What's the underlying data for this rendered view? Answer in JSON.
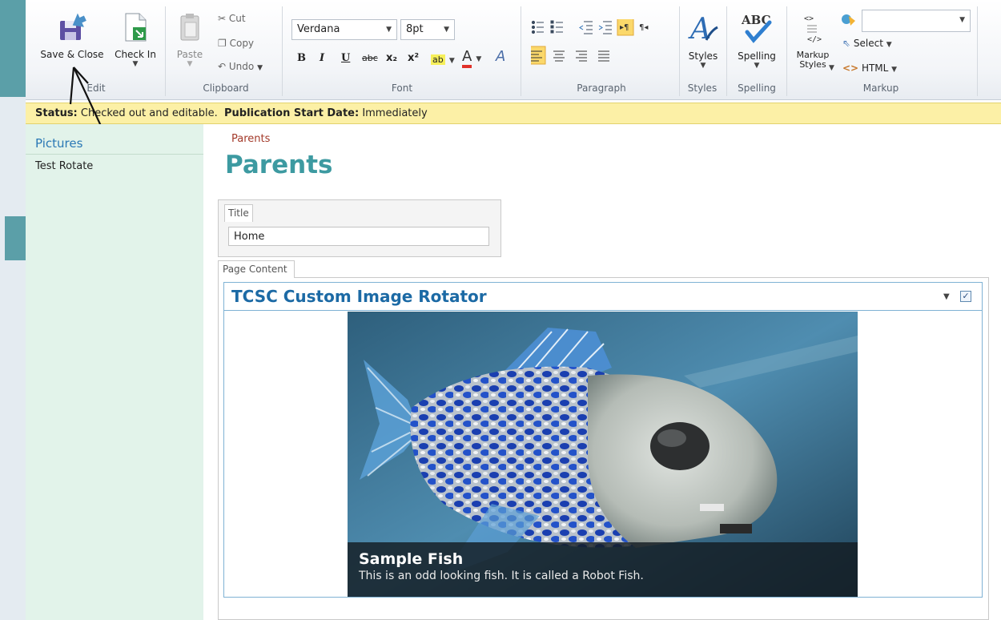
{
  "ribbon": {
    "edit": {
      "group_label": "Edit",
      "save_close_label": "Save & Close",
      "check_in_label": "Check In"
    },
    "clipboard": {
      "group_label": "Clipboard",
      "paste_label": "Paste",
      "cut_label": "Cut",
      "copy_label": "Copy",
      "undo_label": "Undo"
    },
    "font": {
      "group_label": "Font",
      "font_family_value": "Verdana",
      "font_size_value": "8pt",
      "bold_label": "B",
      "italic_label": "I",
      "underline_label": "U",
      "strike_label": "abc",
      "subscript_label": "x₂",
      "superscript_label": "x²",
      "highlight_label": "ab",
      "font_color_label": "A",
      "clear_format_label": "A"
    },
    "paragraph": {
      "group_label": "Paragraph"
    },
    "styles": {
      "group_label": "Styles",
      "styles_label": "Styles"
    },
    "spelling": {
      "group_label": "Spelling",
      "spelling_label": "Spelling",
      "abc_label": "ABC"
    },
    "markup": {
      "group_label": "Markup",
      "markup_styles_label": "Markup Styles",
      "select_label": "Select",
      "html_label": "HTML",
      "markup_dropdown_value": ""
    }
  },
  "status": {
    "status_key": "Status:",
    "status_value": "Checked out and editable.",
    "pub_key": "Publication Start Date:",
    "pub_value": "Immediately"
  },
  "left_nav": {
    "heading": "Pictures",
    "items": [
      {
        "label": "Test Rotate"
      }
    ]
  },
  "page": {
    "breadcrumb": "Parents",
    "title": "Parents",
    "title_field_label": "Title",
    "title_field_value": "Home",
    "page_content_label": "Page Content"
  },
  "webpart": {
    "title": "TCSC Custom Image Rotator",
    "menu_glyph": "▼",
    "check_glyph": "✓",
    "slide": {
      "caption_title": "Sample Fish",
      "caption_text": "This is an odd looking fish. It is called a Robot Fish."
    }
  },
  "colors": {
    "accent_teal": "#5b9fa8",
    "status_yellow": "#fcf0a6",
    "nav_green": "#e2f3ea",
    "title_teal": "#3d9aa1",
    "webpart_blue": "#1c6aa5"
  }
}
